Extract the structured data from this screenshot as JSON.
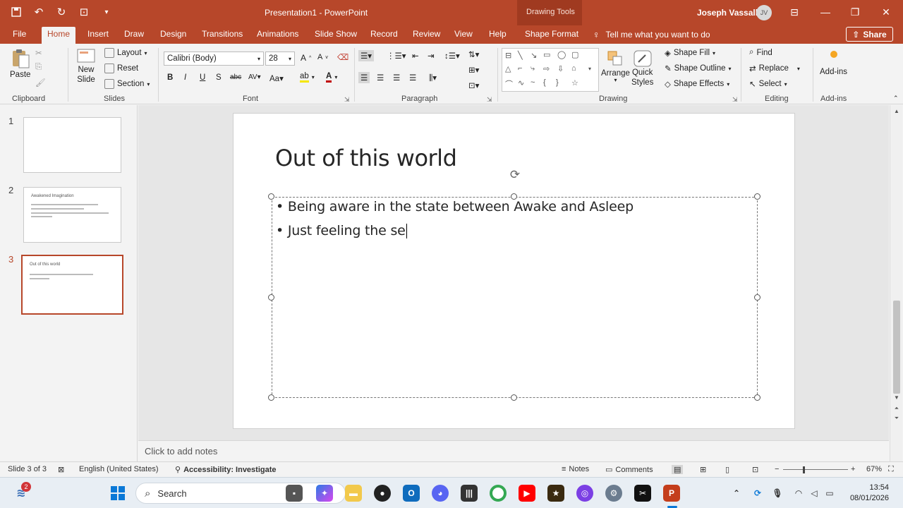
{
  "app": {
    "title": "Presentation1  -  PowerPoint",
    "context_tab_group": "Drawing Tools",
    "user_name": "Joseph Vassallo",
    "user_initials": "JV"
  },
  "tabs": [
    "File",
    "Home",
    "Insert",
    "Draw",
    "Design",
    "Transitions",
    "Animations",
    "Slide Show",
    "Record",
    "Review",
    "View",
    "Help",
    "Shape Format"
  ],
  "active_tab": "Home",
  "tell_me": "Tell me what you want to do",
  "share_label": "Share",
  "ribbon": {
    "clipboard": {
      "label": "Clipboard",
      "paste": "Paste"
    },
    "slides": {
      "label": "Slides",
      "new_slide_1": "New",
      "new_slide_2": "Slide",
      "layout": "Layout",
      "reset": "Reset",
      "section": "Section"
    },
    "font": {
      "label": "Font",
      "family": "Calibri (Body)",
      "size": "28"
    },
    "paragraph": {
      "label": "Paragraph"
    },
    "drawing": {
      "label": "Drawing",
      "arrange": "Arrange",
      "quick_1": "Quick",
      "quick_2": "Styles",
      "shape_fill": "Shape Fill",
      "shape_outline": "Shape Outline",
      "shape_effects": "Shape Effects"
    },
    "editing": {
      "label": "Editing",
      "find": "Find",
      "replace": "Replace",
      "select": "Select"
    },
    "addins": {
      "label": "Add-ins",
      "button": "Add-ins"
    }
  },
  "slides_panel": {
    "numbers": [
      "1",
      "2",
      "3"
    ],
    "thumb2_title": "Awakened Imagination",
    "thumb3_title": "Out of this world"
  },
  "slide": {
    "title": "Out of this world",
    "bullets": [
      "Being aware in the state between Awake and Asleep",
      "Just feeling the se"
    ]
  },
  "notes_placeholder": "Click to add notes",
  "status": {
    "slide_info": "Slide 3 of 3",
    "language": "English (United States)",
    "accessibility": "Accessibility: Investigate",
    "notes": "Notes",
    "comments": "Comments",
    "zoom": "67%"
  },
  "taskbar": {
    "search_placeholder": "Search",
    "badge": "2",
    "time": "13:54",
    "date": "08/01/2026"
  },
  "colors": {
    "accent": "#b7472a"
  }
}
